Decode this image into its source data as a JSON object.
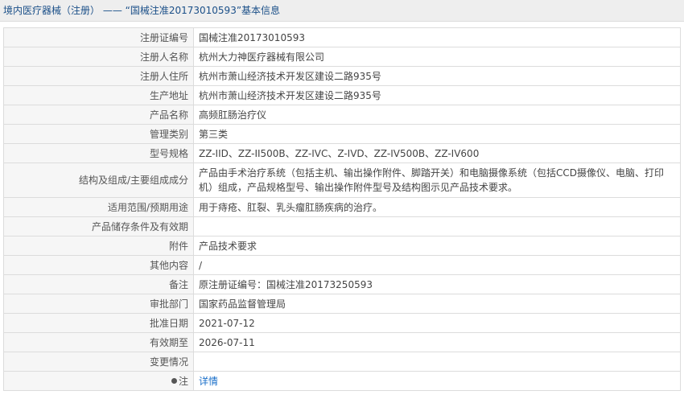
{
  "header": {
    "title": "境内医疗器械（注册） —— “国械注准20173010593”基本信息"
  },
  "rows": [
    {
      "label": "注册证编号",
      "value": "国械注准20173010593"
    },
    {
      "label": "注册人名称",
      "value": "杭州大力神医疗器械有限公司"
    },
    {
      "label": "注册人住所",
      "value": "杭州市萧山经济技术开发区建设二路935号"
    },
    {
      "label": "生产地址",
      "value": "杭州市萧山经济技术开发区建设二路935号"
    },
    {
      "label": "产品名称",
      "value": "高频肛肠治疗仪"
    },
    {
      "label": "管理类别",
      "value": "第三类"
    },
    {
      "label": "型号规格",
      "value": "ZZ-IID、ZZ-II500B、ZZ-IVC、Z-IVD、ZZ-IV500B、ZZ-IV600"
    },
    {
      "label": "结构及组成/主要组成成分",
      "value": "产品由手术治疗系统（包括主机、输出操作附件、脚踏开关）和电脑摄像系统（包括CCD摄像仪、电脑、打印机）组成，产品规格型号、输出操作附件型号及结构图示见产品技术要求。"
    },
    {
      "label": "适用范围/预期用途",
      "value": "用于痔疮、肛裂、乳头瘤肛肠疾病的治疗。"
    },
    {
      "label": "产品储存条件及有效期",
      "value": ""
    },
    {
      "label": "附件",
      "value": "产品技术要求"
    },
    {
      "label": "其他内容",
      "value": "/"
    },
    {
      "label": "备注",
      "value": "原注册证编号：国械注准20173250593"
    },
    {
      "label": "审批部门",
      "value": "国家药品监督管理局"
    },
    {
      "label": "批准日期",
      "value": "2021-07-12"
    },
    {
      "label": "有效期至",
      "value": "2026-07-11"
    },
    {
      "label": "变更情况",
      "value": ""
    }
  ],
  "note_row": {
    "label": "注",
    "icon": "pin-icon",
    "link_text": "详情"
  }
}
